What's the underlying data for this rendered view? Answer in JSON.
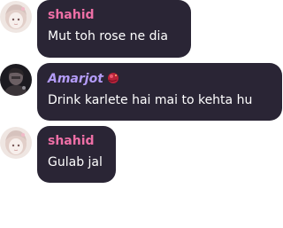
{
  "messages": [
    {
      "author": "shahid",
      "text": "Mut toh rose ne dia",
      "avatar_icon": "anime-girl-avatar-icon",
      "name_color": "#ee6fa6"
    },
    {
      "author": "Amarjot",
      "text": "Drink karlete hai mai to kehta hu",
      "avatar_icon": "dark-figure-avatar-icon",
      "badge_icon": "red-orb-badge-icon",
      "name_color": "#b49cf8"
    },
    {
      "author": "shahid",
      "text": "Gulab jal",
      "avatar_icon": "anime-girl-avatar-icon",
      "name_color": "#ee6fa6"
    }
  ],
  "colors": {
    "bubble_bg": "#2a2535",
    "message_text": "#ffffff",
    "page_bg": "#ffffff"
  }
}
